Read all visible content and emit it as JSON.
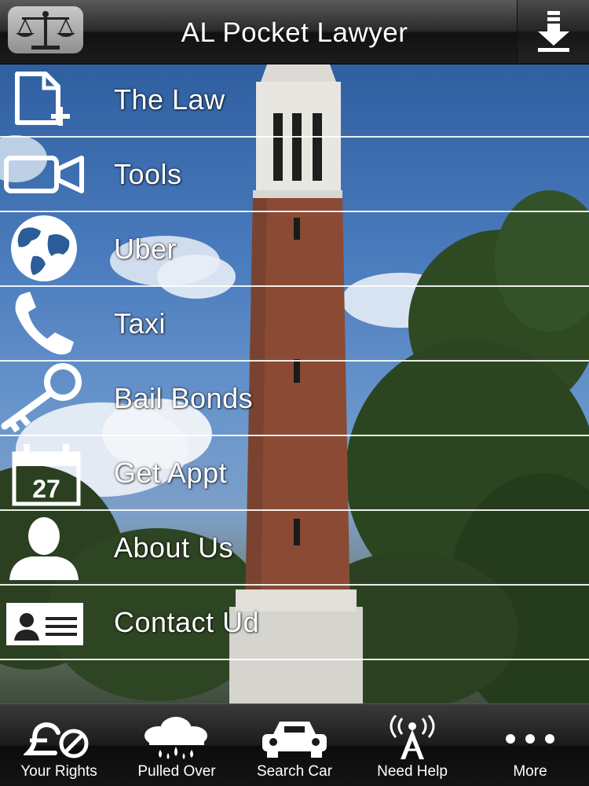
{
  "header": {
    "title": "AL Pocket Lawyer",
    "logo_icon": "scales-of-justice-icon",
    "download_icon": "download-arrow-icon"
  },
  "menu": {
    "items": [
      {
        "label": "The Law",
        "icon": "new-document-icon"
      },
      {
        "label": "Tools",
        "icon": "video-camera-icon"
      },
      {
        "label": "Uber",
        "icon": "globe-icon"
      },
      {
        "label": "Taxi",
        "icon": "phone-icon"
      },
      {
        "label": "Bail Bonds",
        "icon": "key-icon"
      },
      {
        "label": "Get Appt",
        "icon": "calendar-icon",
        "calendar_day": "27"
      },
      {
        "label": "About Us",
        "icon": "person-icon"
      },
      {
        "label": "Contact Ud",
        "icon": "contact-card-icon"
      }
    ]
  },
  "tabbar": {
    "tabs": [
      {
        "label": "Your Rights",
        "icon": "pound-no-icon"
      },
      {
        "label": "Pulled Over",
        "icon": "rain-cloud-icon"
      },
      {
        "label": "Search Car",
        "icon": "car-icon"
      },
      {
        "label": "Need Help",
        "icon": "broadcast-tower-icon"
      },
      {
        "label": "More",
        "icon": "more-dots-icon"
      }
    ]
  },
  "colors": {
    "header_dark": "#1c1c1c",
    "text": "#ffffff",
    "sky": "#4a7bbd",
    "brick": "#8a4a34"
  }
}
